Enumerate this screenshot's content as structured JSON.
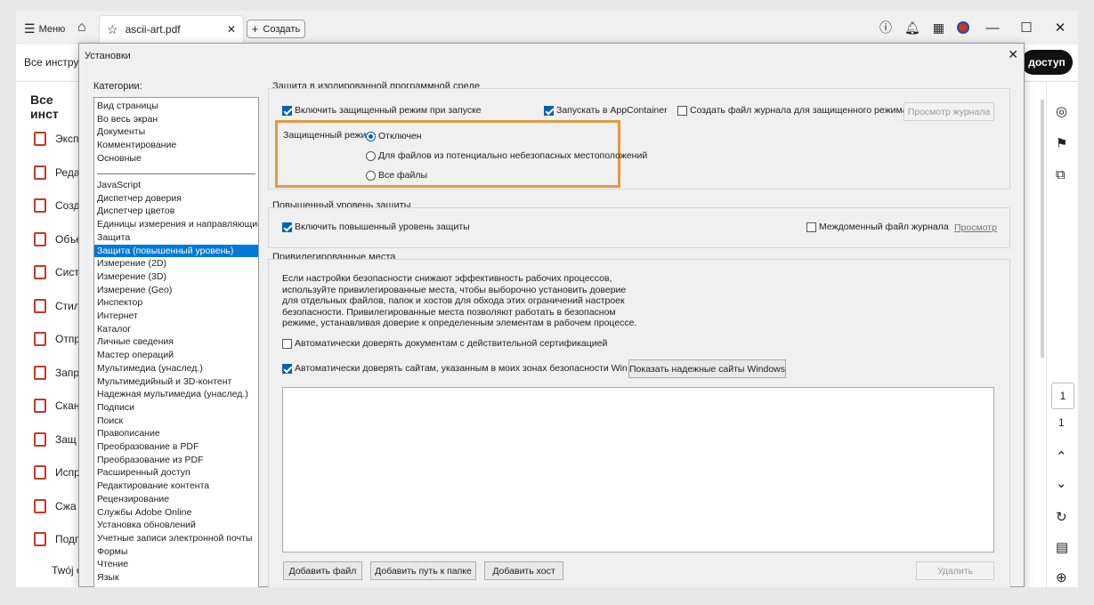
{
  "app": {
    "menu_label": "Меню",
    "tab_title": "ascii-art.pdf",
    "create_label": "Создать",
    "tools_label": "Все инструм",
    "share_label": "доступ",
    "left_heading": "Все инст",
    "left_items": [
      "Эксп",
      "Реда",
      "Созд",
      "Объе",
      "Сист",
      "Стил",
      "Отпр",
      "Запр",
      "Скан",
      "Защ",
      "Испр",
      "Сжа",
      "Подп"
    ],
    "left_footer": "Twój o",
    "page_current": "1",
    "page_total": "1"
  },
  "dialog": {
    "title": "Установки",
    "categories_label": "Категории:",
    "categories_top": [
      "Вид страницы",
      "Во весь экран",
      "Документы",
      "Комментирование",
      "Основные"
    ],
    "categories": [
      "JavaScript",
      "Диспетчер доверия",
      "Диспетчер цветов",
      "Единицы измерения и направляющие",
      "Защита",
      "Защита (повышенный уровень)",
      "Измерение (2D)",
      "Измерение (3D)",
      "Измерение (Geo)",
      "Инспектор",
      "Интернет",
      "Каталог",
      "Личные сведения",
      "Мастер операций",
      "Мультимедиа (унаслед.)",
      "Мультимедийный и 3D-контент",
      "Надежная мультимедиа (унаслед.)",
      "Подписи",
      "Поиск",
      "Правописание",
      "Преобразование в PDF",
      "Преобразование из PDF",
      "Расширенный доступ",
      "Редактирование контента",
      "Рецензирование",
      "Службы Adobe Online",
      "Установка обновлений",
      "Учетные записи электронной почты",
      "Формы",
      "Чтение",
      "Язык"
    ],
    "selected_category": "Защита (повышенный уровень)",
    "sandbox": {
      "title": "Защита в изолированной программной среде",
      "enable_protected": "Включить защищенный режим при запуске",
      "run_appcontainer": "Запускать в AppContainer",
      "create_log": "Создать файл журнала для защищенного режима",
      "view_log": "Просмотр журнала",
      "protected_mode_label": "Защищенный режим",
      "radio_off": "Отключен",
      "radio_unsafe": "Для файлов из потенциально небезопасных местоположений",
      "radio_all": "Все файлы"
    },
    "enhanced": {
      "title": "Повышенный уровень защиты",
      "enable_enhanced": "Включить повышенный уровень защиты",
      "crossdomain_log": "Междоменный файл журнала",
      "view_link": "Просмотр"
    },
    "privileged": {
      "title": "Привилегированные места",
      "description": "Если настройки безопасности снижают эффективность рабочих процессов, используйте привилегированные места, чтобы выборочно установить доверие для отдельных файлов, папок и хостов для обхода этих ограничений настроек безопасности. Привилегированные места позволяют работать в безопасном режиме, устанавливая доверие к определенным элементам в рабочем процессе.",
      "trust_certified": "Автоматически доверять документам с действительной сертификацией",
      "trust_win_zones": "Автоматически доверять сайтам, указанным в моих зонах безопасности Win OS",
      "show_trusted_sites": "Показать надежные сайты Windows",
      "add_file": "Добавить файл",
      "add_folder": "Добавить путь к папке",
      "add_host": "Добавить хост",
      "remove": "Удалить"
    }
  },
  "colors": {
    "accent": "#0063b1",
    "selection": "#0078d7",
    "highlight_border": "#e29b3e"
  }
}
